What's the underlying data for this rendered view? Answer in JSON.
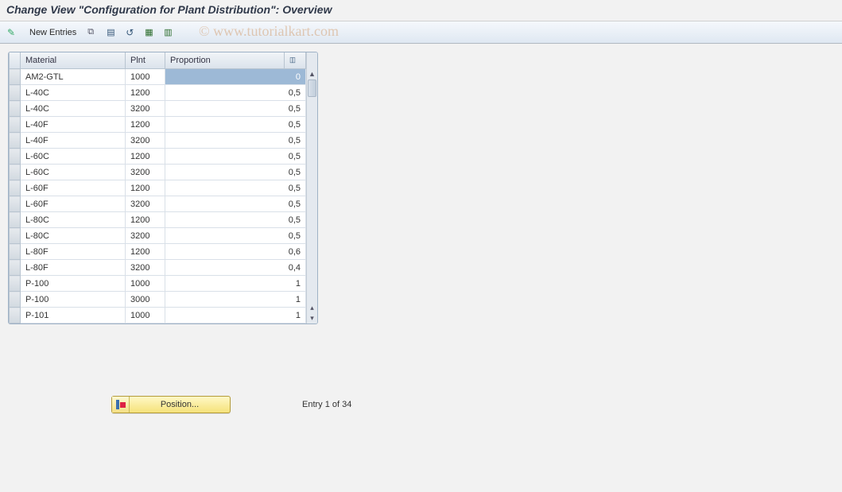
{
  "title": "Change View \"Configuration for Plant Distribution\": Overview",
  "toolbar": {
    "new_entries": "New Entries"
  },
  "watermark": "© www.tutorialkart.com",
  "columns": {
    "material": "Material",
    "plnt": "Plnt",
    "proportion": "Proportion"
  },
  "rows": [
    {
      "material": "AM2-GTL",
      "plnt": "1000",
      "proportion": "0",
      "active": true
    },
    {
      "material": "L-40C",
      "plnt": "1200",
      "proportion": "0,5"
    },
    {
      "material": "L-40C",
      "plnt": "3200",
      "proportion": "0,5"
    },
    {
      "material": "L-40F",
      "plnt": "1200",
      "proportion": "0,5"
    },
    {
      "material": "L-40F",
      "plnt": "3200",
      "proportion": "0,5"
    },
    {
      "material": "L-60C",
      "plnt": "1200",
      "proportion": "0,5"
    },
    {
      "material": "L-60C",
      "plnt": "3200",
      "proportion": "0,5"
    },
    {
      "material": "L-60F",
      "plnt": "1200",
      "proportion": "0,5"
    },
    {
      "material": "L-60F",
      "plnt": "3200",
      "proportion": "0,5"
    },
    {
      "material": "L-80C",
      "plnt": "1200",
      "proportion": "0,5"
    },
    {
      "material": "L-80C",
      "plnt": "3200",
      "proportion": "0,5"
    },
    {
      "material": "L-80F",
      "plnt": "1200",
      "proportion": "0,6"
    },
    {
      "material": "L-80F",
      "plnt": "3200",
      "proportion": "0,4"
    },
    {
      "material": "P-100",
      "plnt": "1000",
      "proportion": "1"
    },
    {
      "material": "P-100",
      "plnt": "3000",
      "proportion": "1"
    },
    {
      "material": "P-101",
      "plnt": "1000",
      "proportion": "1"
    }
  ],
  "footer": {
    "position_label": "Position...",
    "entry_info": "Entry 1 of 34"
  }
}
